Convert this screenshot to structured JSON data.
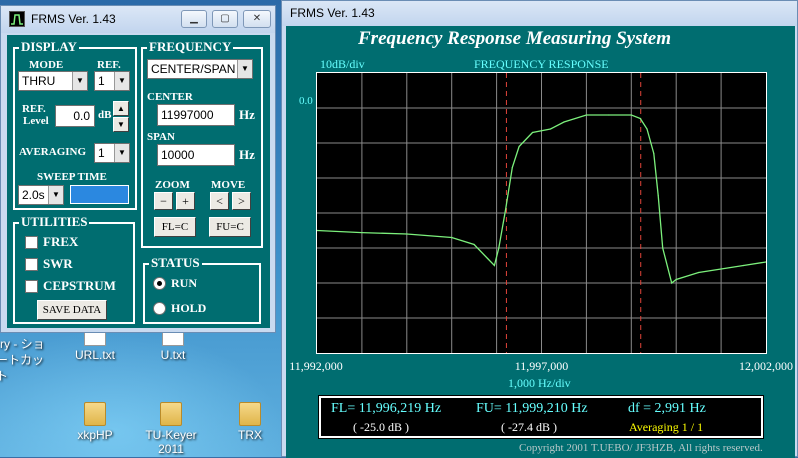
{
  "desktop": {
    "icons": [
      {
        "label": "rry - ショ"
      },
      {
        "label": "ートカット"
      },
      {
        "label": "URL.txt"
      },
      {
        "label": "U.txt"
      },
      {
        "label": "xkpHP"
      },
      {
        "label": "TU-Keyer"
      },
      {
        "label": "2011"
      },
      {
        "label": "TRX"
      }
    ]
  },
  "control_window": {
    "title": "FRMS  Ver. 1.43",
    "display": {
      "title": "DISPLAY",
      "mode_label": "MODE",
      "mode_value": "THRU",
      "ref_label": "REF.",
      "ref_value": "1",
      "ref_level_label_1": "REF.",
      "ref_level_label_2": "Level",
      "ref_level_value": "0.0",
      "ref_level_unit": "dB",
      "averaging_label": "AVERAGING",
      "averaging_value": "1",
      "sweep_label": "SWEEP TIME",
      "sweep_value": "2.0s",
      "sweep_bar_color": "#2b88e0"
    },
    "frequency": {
      "title": "FREQUENCY",
      "mode_value": "CENTER/SPAN",
      "center_label": "CENTER",
      "center_value": "11997000",
      "span_label": "SPAN",
      "span_value": "10000",
      "unit": "Hz",
      "zoom_label": "ZOOM",
      "move_label": "MOVE",
      "zoom_out": "−",
      "zoom_in": "+",
      "move_left": "<",
      "move_right": ">",
      "fl_button": "FL=C",
      "fu_button": "FU=C"
    },
    "utilities": {
      "title": "UTILITIES",
      "items": [
        "FREX",
        "SWR",
        "CEPSTRUM"
      ],
      "save_button": "SAVE DATA"
    },
    "status": {
      "title": "STATUS",
      "run_label": "RUN",
      "hold_label": "HOLD",
      "selected": "RUN"
    }
  },
  "graph_window": {
    "title": "FRMS  Ver. 1.43",
    "heading": "Frequency Response Measuring System",
    "scale_label": "10dB/div",
    "plot_label": "FREQUENCY RESPONSE",
    "ref_tick": "0.0",
    "x_ticks": [
      "11,992,000",
      "11,997,000",
      "12,002,000"
    ],
    "x_div": "1,000  Hz/div",
    "fl_text": "FL= 11,996,219  Hz",
    "fu_text": "FU= 11,999,210  Hz",
    "df_text": "df = 2,991  Hz",
    "fl_db": "( -25.0 dB )",
    "fu_db": "( -27.4 dB )",
    "averaging_text": "Averaging   1 / 1",
    "copyright": "Copyright 2001 T.UEBO/ JF3HZB, All rights reserved.",
    "trace_color": "#7cf07c",
    "marker_color": "#e0443a"
  },
  "chart_data": {
    "type": "line",
    "title": "FREQUENCY RESPONSE",
    "xlabel": "1,000  Hz/div",
    "ylabel": "10dB/div",
    "xlim": [
      11992000,
      12002000
    ],
    "ylim": [
      -80,
      0
    ],
    "x_ticks": [
      11992000,
      11997000,
      12002000
    ],
    "markers": {
      "FL": 11996219,
      "FU": 11999210
    },
    "grid": true,
    "series": [
      {
        "x": [
          11992000,
          11993000,
          11994000,
          11995000,
          11995500,
          11995800,
          11995950,
          11996050,
          11996200,
          11996350,
          11996500,
          11996800,
          11997200,
          11997500,
          11998000,
          11998500,
          11999000,
          11999200,
          11999350,
          11999500,
          11999600,
          11999700,
          11999900,
          12000000,
          12000500,
          12001000,
          12001500,
          12002000
        ],
        "y": [
          -45,
          -45.6,
          -46,
          -47,
          -49,
          -53,
          -55,
          -50,
          -39,
          -27,
          -21,
          -17,
          -16,
          -14,
          -12,
          -12,
          -12,
          -13,
          -16,
          -23,
          -35,
          -50,
          -60,
          -59,
          -57,
          -56,
          -55,
          -54
        ]
      }
    ]
  }
}
